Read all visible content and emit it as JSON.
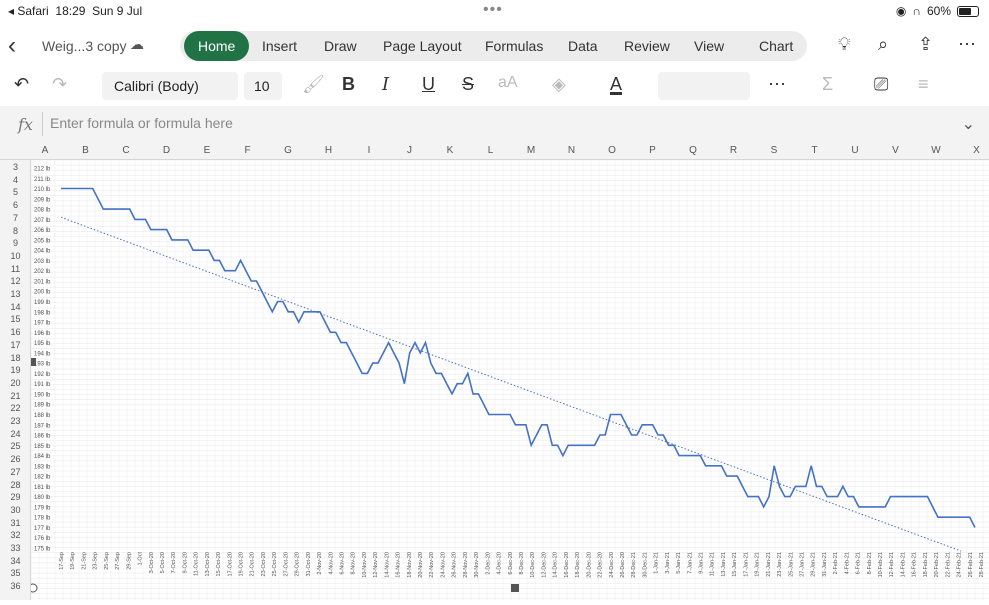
{
  "status": {
    "app": "◂ Safari",
    "time": "18:29",
    "date": "Sun 9 Jul",
    "battery": "60%"
  },
  "file": {
    "name": "Weig...3 copy"
  },
  "tabs": [
    "Home",
    "Insert",
    "Draw",
    "Page Layout",
    "Formulas",
    "Data",
    "Review",
    "View",
    "Chart"
  ],
  "active_tab": "Home",
  "toolbar": {
    "font": "Calibri (Body)",
    "size": "10",
    "bold": "B",
    "italic": "I",
    "underline": "U",
    "strike": "S",
    "fontsize_btn": "aA",
    "fontcolor": "A"
  },
  "formula": {
    "placeholder": "Enter formula or formula here",
    "label": "fx"
  },
  "columns": [
    "A",
    "B",
    "C",
    "D",
    "E",
    "F",
    "G",
    "H",
    "I",
    "J",
    "K",
    "L",
    "M",
    "N",
    "O",
    "P",
    "Q",
    "R",
    "S",
    "T",
    "U",
    "V",
    "W",
    "X"
  ],
  "rows": [
    "3",
    "4",
    "5",
    "6",
    "7",
    "8",
    "9",
    "10",
    "11",
    "12",
    "13",
    "14",
    "15",
    "16",
    "17",
    "18",
    "19",
    "20",
    "21",
    "22",
    "23",
    "24",
    "25",
    "26",
    "27",
    "28",
    "29",
    "30",
    "31",
    "32",
    "33",
    "34",
    "35",
    "36"
  ],
  "colors": {
    "accent": "#217346",
    "line": "#4472c4",
    "trend": "#4472c4"
  },
  "chart_data": {
    "type": "line",
    "title": "",
    "xlabel": "",
    "ylabel": "",
    "y_ticks": [
      "212 lb",
      "211 lb",
      "210 lb",
      "209 lb",
      "208 lb",
      "207 lb",
      "206 lb",
      "205 lb",
      "204 lb",
      "203 lb",
      "202 lb",
      "201 lb",
      "200 lb",
      "199 lb",
      "198 lb",
      "197 lb",
      "196 lb",
      "195 lb",
      "194 lb",
      "193 lb",
      "192 lb",
      "191 lb",
      "190 lb",
      "189 lb",
      "188 lb",
      "187 lb",
      "186 lb",
      "185 lb",
      "184 lb",
      "183 lb",
      "182 lb",
      "181 lb",
      "180 lb",
      "179 lb",
      "178 lb",
      "177 lb",
      "176 lb",
      "175 lb"
    ],
    "ylim": [
      175,
      212
    ],
    "x_ticks": [
      "17-Sep",
      "19-Sep",
      "21-Sep",
      "23-Sep",
      "25-Sep",
      "27-Sep",
      "29-Sep",
      "1-Oct",
      "3-Oct-20",
      "5-Oct-20",
      "7-Oct-20",
      "9-Oct-20",
      "11-Oct-20",
      "13-Oct-20",
      "15-Oct-20",
      "17-Oct-20",
      "19-Oct-20",
      "21-Oct-20",
      "23-Oct-20",
      "25-Oct-20",
      "27-Oct-20",
      "29-Oct-20",
      "31-Oct-20",
      "2-Nov-20",
      "4-Nov-20",
      "6-Nov-20",
      "8-Nov-20",
      "10-Nov-20",
      "12-Nov-20",
      "14-Nov-20",
      "16-Nov-20",
      "18-Nov-20",
      "20-Nov-20",
      "22-Nov-20",
      "24-Nov-20",
      "26-Nov-20",
      "28-Nov-20",
      "30-Nov-20",
      "2-Dec-20",
      "4-Dec-20",
      "6-Dec-20",
      "8-Dec-20",
      "10-Dec-20",
      "12-Dec-20",
      "14-Dec-20",
      "16-Dec-20",
      "18-Dec-20",
      "20-Dec-20",
      "22-Dec-20",
      "24-Dec-20",
      "26-Dec-20",
      "28-Dec-21",
      "30-Dec-21",
      "1-Jan-21",
      "3-Jan-21",
      "5-Jan-21",
      "7-Jan-21",
      "9-Jan-21",
      "11-Jan-21",
      "13-Jan-21",
      "15-Jan-21",
      "17-Jan-21",
      "19-Jan-21",
      "21-Jan-21",
      "23-Jan-21",
      "25-Jan-21",
      "27-Jan-21",
      "29-Jan-21",
      "31-Jan-21",
      "2-Feb-21",
      "4-Feb-21",
      "6-Feb-21",
      "8-Feb-21",
      "10-Feb-21",
      "12-Feb-21",
      "14-Feb-21",
      "16-Feb-21",
      "18-Feb-21",
      "20-Feb-21",
      "22-Feb-21",
      "24-Feb-21",
      "26-Feb-21",
      "28-Feb-21"
    ],
    "series": [
      {
        "values": [
          210,
          210,
          210,
          210,
          210,
          210,
          210,
          209,
          208,
          208,
          208,
          208,
          208,
          208,
          207,
          207,
          207,
          206,
          206,
          206,
          206,
          205,
          205,
          205,
          205,
          204,
          204,
          204,
          204,
          203,
          203,
          202,
          202,
          202,
          203,
          202,
          201,
          201,
          200,
          199,
          198,
          199,
          199,
          198,
          198,
          197,
          198,
          198,
          198,
          198,
          197,
          196,
          196,
          195,
          195,
          194,
          193,
          192,
          192,
          193,
          193,
          194,
          195,
          194,
          193,
          191,
          194,
          195,
          194,
          195,
          193,
          192,
          192,
          191,
          190,
          191,
          191,
          192,
          190,
          190,
          189,
          188,
          188,
          188,
          188,
          188,
          187,
          187,
          187,
          185,
          186,
          187,
          187,
          185,
          185,
          184,
          185,
          185,
          185,
          185,
          185,
          185,
          186,
          186,
          188,
          188,
          188,
          187,
          186,
          186,
          187,
          187,
          187,
          186,
          186,
          185,
          185,
          184,
          184,
          184,
          184,
          184,
          183,
          183,
          183,
          183,
          182,
          182,
          182,
          181,
          180,
          180,
          180,
          179,
          180,
          183,
          181,
          180,
          180,
          181,
          181,
          181,
          183,
          181,
          181,
          180,
          180,
          180,
          181,
          180,
          180,
          179,
          179,
          179,
          179,
          179,
          179,
          180,
          180,
          180,
          180,
          180,
          180,
          180,
          180,
          179,
          178,
          178,
          178,
          178,
          178,
          178,
          178,
          177
        ]
      }
    ],
    "trendline": {
      "start": 207.2,
      "end": 174.7,
      "style": "dotted"
    },
    "grid": true,
    "legend": "none"
  }
}
